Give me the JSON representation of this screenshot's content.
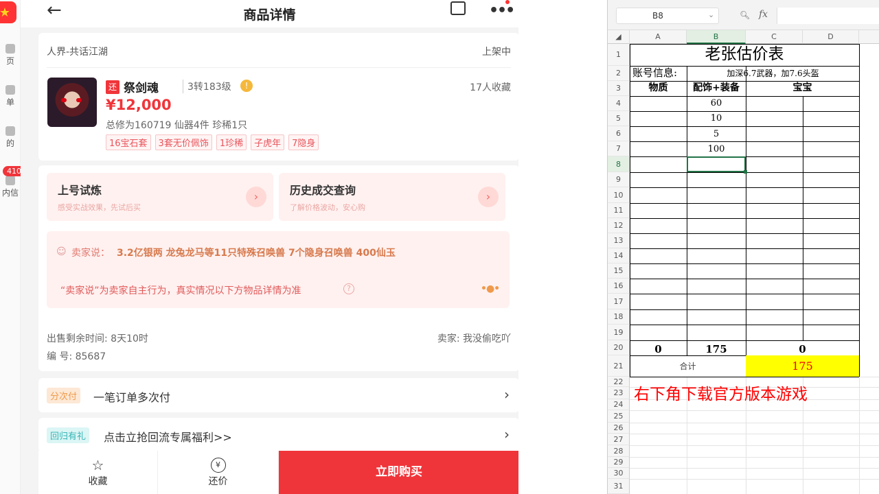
{
  "left_strip": {
    "items": [
      "页",
      "单",
      "的",
      "内信"
    ],
    "badge": "410"
  },
  "app": {
    "nav": {
      "title": "商品详情",
      "back_glyph": "←",
      "more_glyph": "•••"
    },
    "product": {
      "server": "人界-共话江湖",
      "status": "上架中",
      "badge": "还",
      "name": "祭剑魂",
      "level": "3转183级",
      "favorites": "17人收藏",
      "price": "¥12,000",
      "stats": "总修为160719  仙器4件  珍稀1只",
      "tags": [
        "16宝石套",
        "3套无价佩饰",
        "1珍稀",
        "子虎年",
        "7隐身"
      ]
    },
    "actions": [
      {
        "title": "上号试炼",
        "subtitle": "感受实战效果，先试后买"
      },
      {
        "title": "历史成交查询",
        "subtitle": "了解价格波动，安心购"
      }
    ],
    "seller_says": {
      "label": "卖家说：",
      "text": "3.2亿银两 龙兔龙马等11只特殊召唤兽 7个隐身召唤兽 400仙玉",
      "disclaimer": "“卖家说”为卖家自主行为，真实情况以下方物品详情为准"
    },
    "meta": {
      "time_left": "出售剩余时间: 8天10时",
      "seller": "卖家: 我没偷吃吖",
      "code": "编 号: 85687"
    },
    "rows": [
      {
        "pill": "分次付",
        "text": "一笔订单多次付"
      },
      {
        "pill": "回归有礼",
        "text": "点击立抢回流专属福利>>"
      }
    ],
    "bottom": {
      "favorite": "收藏",
      "counter": "还价",
      "buy": "立即购买",
      "counter_icon": "¥"
    }
  },
  "sheet": {
    "name_box": "B8",
    "fx": "fx",
    "columns": [
      "A",
      "B",
      "C",
      "D"
    ],
    "rows": [
      "1",
      "2",
      "3",
      "4",
      "5",
      "6",
      "7",
      "8",
      "9",
      "10",
      "11",
      "12",
      "13",
      "14",
      "15",
      "16",
      "17",
      "18",
      "19",
      "20",
      "21",
      "22",
      "23",
      "24",
      "25",
      "26",
      "27",
      "28",
      "29",
      "30",
      "31"
    ],
    "title": "老张估价表",
    "account_label": "账号信息:",
    "account_info": "加深6.7武器，加7.6头盔",
    "headers": {
      "quality": "物质",
      "gear": "配饰+装备",
      "pet": "宝宝"
    },
    "gear_values": [
      "60",
      "10",
      "5",
      "100"
    ],
    "totals": {
      "quality": "0",
      "gear": "175",
      "pet": "0"
    },
    "sum_label": "合计",
    "sum_value": "175",
    "promo": "右下角下载官方版本游戏",
    "accent_green": "#217346",
    "highlight_yellow": "#ffff00",
    "promo_red": "#ff0000"
  }
}
